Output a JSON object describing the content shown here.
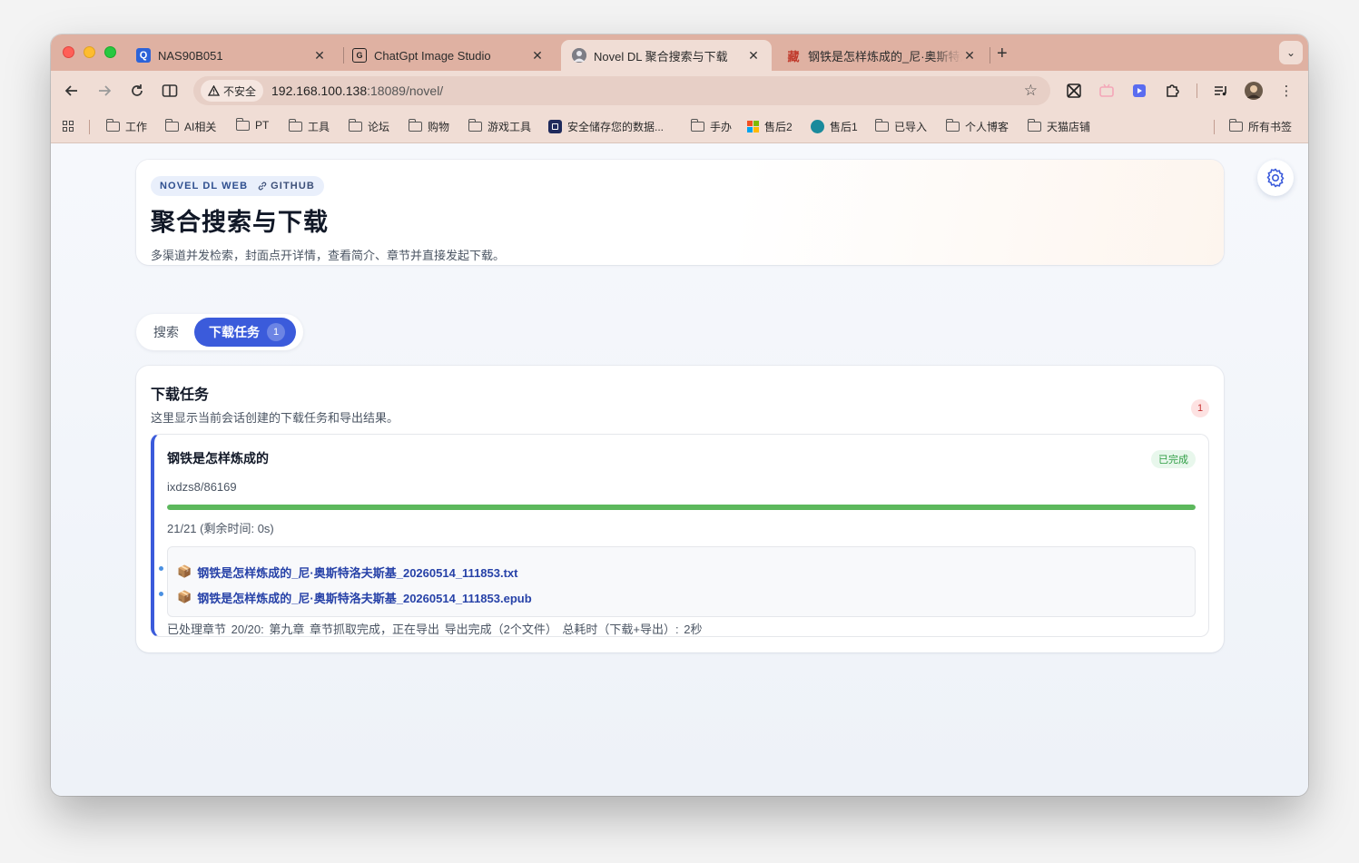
{
  "browser": {
    "tabs": [
      {
        "title": "NAS90B051",
        "favicon": "Q",
        "close": "✕"
      },
      {
        "title": "ChatGpt Image Studio",
        "favicon": "G",
        "close": "✕"
      },
      {
        "title": "Novel DL 聚合搜索与下载",
        "favicon": "avatar",
        "close": "✕",
        "active": true
      },
      {
        "title": "钢铁是怎样炼成的_尼·奥斯特洛",
        "favicon": "藏",
        "close": "✕"
      }
    ],
    "new_tab": "+",
    "tab_menu": "⌄",
    "security_label": "不安全",
    "url_host": "192.168.100.138",
    "url_rest": ":18089/novel/",
    "bookmarks": [
      "工作",
      "AI相关",
      "PT",
      "工具",
      "论坛",
      "购物",
      "游戏工具",
      "安全储存您的数据...",
      "手办",
      "售后2",
      "售后1",
      "已导入",
      "个人博客",
      "天猫店铺"
    ],
    "all_bookmarks": "所有书签"
  },
  "hero": {
    "badge": "NOVEL DL WEB",
    "github": "GITHUB",
    "title": "聚合搜索与下载",
    "subtitle": "多渠道并发检索，封面点开详情，查看简介、章节并直接发起下载。"
  },
  "tabs": {
    "search": "搜索",
    "downloads": "下载任务",
    "downloads_count": "1"
  },
  "panel": {
    "title": "下载任务",
    "subtitle": "这里显示当前会话创建的下载任务和导出结果。",
    "count": "1"
  },
  "task": {
    "title": "钢铁是怎样炼成的",
    "status": "已完成",
    "source": "ixdzs8/86169",
    "progress": 1.0,
    "progress_text": "21/21 (剩余时间: 0s)",
    "files": [
      "钢铁是怎样炼成的_尼·奥斯特洛夫斯基_20260514_111853.txt",
      "钢铁是怎样炼成的_尼·奥斯特洛夫斯基_20260514_111853.epub"
    ],
    "log": "已处理章节 20/20: 第九章  章节抓取完成，正在导出  导出完成（2个文件）  总耗时（下载+导出）: 2秒"
  },
  "colors": {
    "accent": "#3b5bdb",
    "success": "#5cb85c",
    "tabstrip": "#dfb1a2"
  }
}
